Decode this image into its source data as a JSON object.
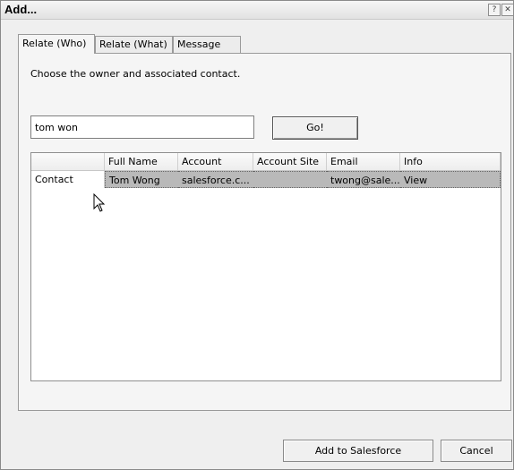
{
  "window": {
    "title": "Add...",
    "help_glyph": "?",
    "close_glyph": "✕"
  },
  "tabs": [
    {
      "label": "Relate (Who)",
      "active": true
    },
    {
      "label": "Relate (What)",
      "active": false
    },
    {
      "label": "Message",
      "active": false
    }
  ],
  "panel": {
    "instruction": "Choose the owner and associated contact."
  },
  "search": {
    "value": "tom won",
    "go_label": "Go!"
  },
  "grid": {
    "columns": [
      "",
      "Full Name",
      "Account",
      "Account Site",
      "Email",
      "Info"
    ],
    "rows": [
      {
        "type": "Contact",
        "full_name": "Tom Wong",
        "account": "salesforce.c...",
        "account_site": "",
        "email": "twong@sale...",
        "info": "View",
        "selected": true
      }
    ]
  },
  "footer": {
    "add_label": "Add to Salesforce",
    "cancel_label": "Cancel"
  },
  "colors": {
    "selected_row": "#b9b9b9",
    "dialog_bg": "#efefef"
  }
}
